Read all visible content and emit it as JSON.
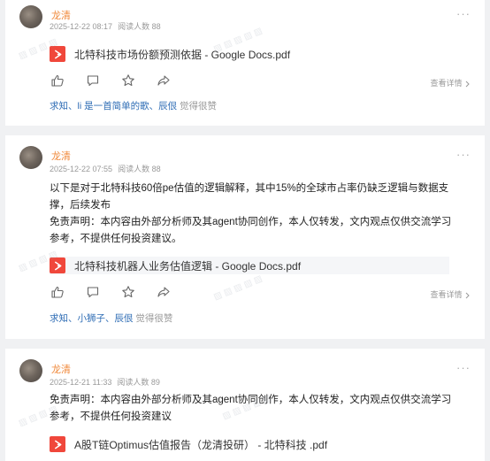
{
  "posts": [
    {
      "author": "龙清",
      "date": "2025-12-22 08:17",
      "readers": "阅读人数 88",
      "more": "···",
      "file": "北特科技市场份额预测依据 - Google Docs.pdf",
      "detail": "查看详情",
      "likes": "求知、li 是一首简单的歌、辰佷",
      "likes_suffix": " 觉得很赞"
    },
    {
      "author": "龙清",
      "date": "2025-12-22 07:55",
      "readers": "阅读人数 88",
      "more": "···",
      "text_lines": [
        "以下是对于北特科技60倍pe估值的逻辑解释，其中15%的全球市占率仍缺乏逻辑与数据支",
        "撑，后续发布",
        "免责声明：本内容由外部分析师及其agent协同创作，本人仅转发，文内观点仅供交流学习",
        "参考，不提供任何投资建议。"
      ],
      "file": "北特科技机器人业务估值逻辑 - Google Docs.pdf",
      "detail": "查看详情",
      "likes": "求知、小狮子、辰佷",
      "likes_suffix": " 觉得很赞"
    },
    {
      "author": "龙清",
      "date": "2025-12-21 11:33",
      "readers": "阅读人数 89",
      "more": "···",
      "text_lines": [
        "免责声明：本内容由外部分析师及其agent协同创作，本人仅转发，文内观点仅供交流学习",
        "参考，不提供任何投资建议"
      ],
      "file": "A股T链Optimus估值报告（龙清投研） - 北特科技 .pdf"
    }
  ],
  "icons": {
    "pdf": "pdf-file-icon",
    "like": "thumbs-up-icon",
    "comment": "comment-icon",
    "favorite": "star-icon",
    "share": "share-icon",
    "chevron": "chevron-right-icon"
  },
  "colors": {
    "author": "#f08a3c",
    "link": "#2f6db5",
    "pdf": "#f0473b"
  }
}
